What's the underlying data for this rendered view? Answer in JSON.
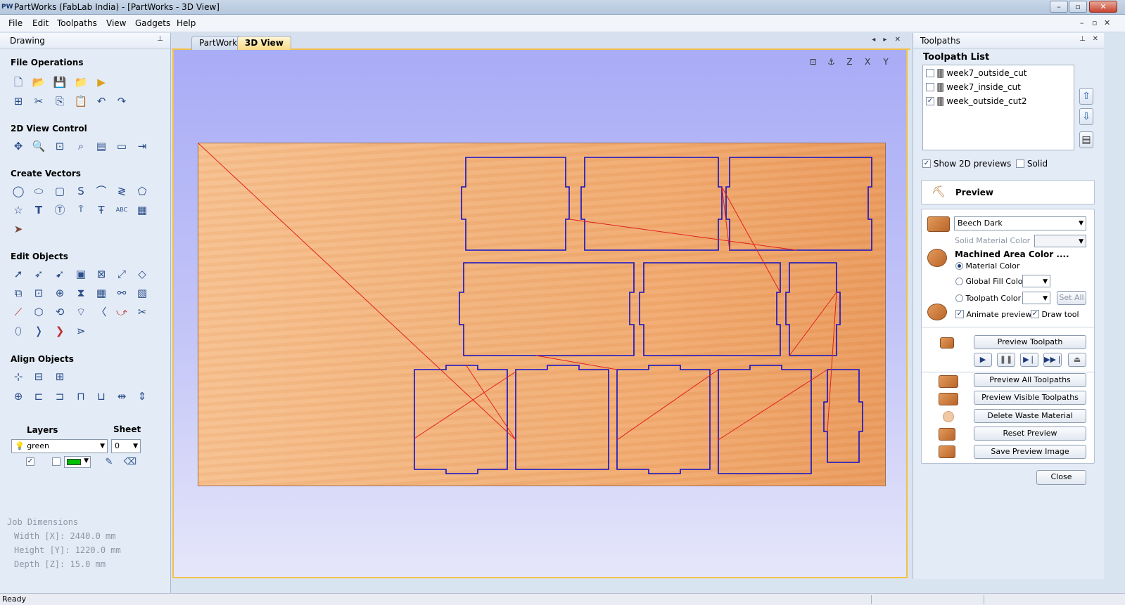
{
  "window": {
    "logo": "PW",
    "title": "PartWorks (FabLab India) - [PartWorks - 3D View]",
    "min_glyph": "–",
    "max_glyph": "▫",
    "close_glyph": "✕"
  },
  "menu": {
    "items": [
      "File",
      "Edit",
      "Toolpaths",
      "View",
      "Gadgets",
      "Help"
    ],
    "mdi_glyphs": [
      "–",
      "▫",
      "✕"
    ]
  },
  "left_panel": {
    "title": "Drawing",
    "pin_glyph": "⊥",
    "sections": {
      "file_operations": "File Operations",
      "view_control": "2D View Control",
      "create_vectors": "Create Vectors",
      "edit_objects": "Edit Objects",
      "align_objects": "Align Objects"
    },
    "icons": {
      "file_operations": [
        "new-file-icon",
        "open-folder-icon",
        "save-icon",
        "open-recent-icon",
        "import-icon",
        "select-all-icon",
        "cut-icon",
        "copy-icon",
        "paste-icon",
        "undo-icon",
        "redo-icon"
      ],
      "view_control": [
        "pan-icon",
        "zoom-icon",
        "zoom-extents-icon",
        "zoom-box-icon",
        "layout-icon",
        "ruler-icon",
        "export-icon"
      ],
      "create_vectors": [
        "circle-icon",
        "ellipse-icon",
        "rectangle-icon",
        "polyline-icon",
        "arc-icon",
        "curve-icon",
        "polygon-icon",
        "star-icon",
        "text-icon",
        "text-box-icon",
        "text-on-curve-icon",
        "text-arc-icon",
        "text-warp-icon",
        "array-icon",
        "bitmap-trace-icon"
      ],
      "edit_objects": [
        "select-icon",
        "node-edit-icon",
        "transform-icon",
        "group-icon",
        "ungroup-icon",
        "mirror-icon",
        "scale-icon",
        "move-icon",
        "align-center-icon",
        "flip-icon",
        "weld-icon",
        "join-icon",
        "offset-icon",
        "trim-icon",
        "fillet-icon",
        "extend-icon",
        "boolean-icon",
        "lasso-icon",
        "smooth-icon",
        "scissors-icon",
        "close-vector-icon",
        "dogbone-icon",
        "tab-icon",
        "chevron-icon"
      ],
      "align_objects": [
        "align-center-icon",
        "align-hcenter-icon",
        "align-vcenter-icon",
        "align-page-center-icon",
        "align-left-icon",
        "align-right-icon",
        "align-top-icon",
        "align-bottom-icon",
        "space-h-icon",
        "space-v-icon"
      ]
    },
    "layers": {
      "label": "Layers",
      "sheet_label": "Sheet",
      "layer_value": "green",
      "sheet_value": "0",
      "color_swatch": "#00c000"
    },
    "job_dimensions": {
      "title": "Job Dimensions",
      "width": "Width  [X]: 2440.0 mm",
      "height": "Height [Y]: 1220.0 mm",
      "depth": "Depth  [Z]: 15.0 mm"
    }
  },
  "doc_tabs": [
    "PartWorks",
    "3D View"
  ],
  "doc_nav": "◂ ▸ ✕",
  "view_icons": [
    "⊡",
    "⚓",
    "Z",
    "X",
    "Y"
  ],
  "right_panel": {
    "title": "Toolpaths",
    "pin_glyph": "⊥",
    "close_glyph": "✕",
    "list_title": "Toolpath List",
    "toolpaths": [
      {
        "name": "week7_outside_cut",
        "checked": false
      },
      {
        "name": "week7_inside_cut",
        "checked": false
      },
      {
        "name": "week_outside_cut2",
        "checked": true
      }
    ],
    "show_2d_previews": "Show 2D previews",
    "solid": "Solid",
    "preview_header": "Preview",
    "material": "Beech Dark",
    "solid_material_color": "Solid Material Color",
    "machined_area_color": "Machined Area Color ....",
    "material_color": "Material Color",
    "global_fill_color": "Global Fill Color",
    "toolpath_color": "Toolpath Color",
    "set_all": "Set All",
    "animate_preview": "Animate preview",
    "draw_tool": "Draw tool",
    "preview_toolpath": "Preview Toolpath",
    "transport": [
      "▶",
      "❚❚",
      "▶❘",
      "▶▶❘",
      "⏏"
    ],
    "preview_all": "Preview All Toolpaths",
    "preview_visible": "Preview Visible Toolpaths",
    "delete_waste": "Delete Waste Material",
    "reset_preview": "Reset Preview",
    "save_preview": "Save Preview Image",
    "close": "Close",
    "check_glyph": "✓",
    "up_glyph": "⇧",
    "down_glyph": "⇩",
    "doc_glyph": "▤"
  },
  "status": "Ready",
  "colors": {
    "cut_outline": "#1010c8",
    "rapid_move": "#e02020",
    "accent_tab": "#f3c04a"
  }
}
